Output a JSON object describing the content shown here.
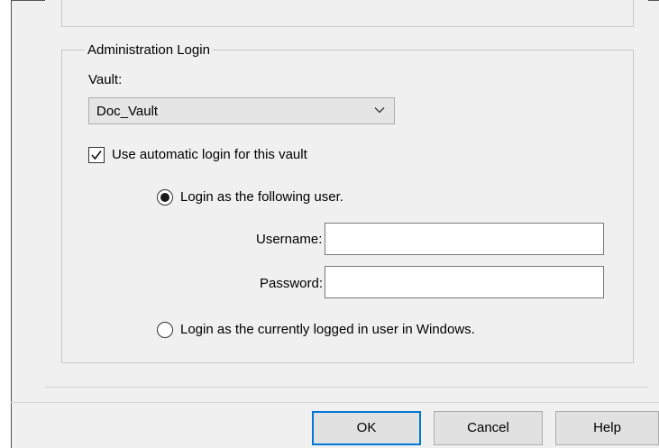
{
  "group": {
    "title": "Administration Login",
    "vault_label": "Vault:",
    "vault_selected": "Doc_Vault",
    "auto_login_label": "Use automatic login for this vault",
    "auto_login_checked": true,
    "radio_login_user_label": "Login as the following user.",
    "radio_login_user_selected": true,
    "username_label": "Username:",
    "username_value": "",
    "password_label": "Password:",
    "password_value": "",
    "radio_windows_user_label": "Login as the currently logged in user in Windows.",
    "radio_windows_user_selected": false
  },
  "buttons": {
    "ok": "OK",
    "cancel": "Cancel",
    "help": "Help"
  },
  "icons": {
    "combo_arrow": "chevron-down-icon",
    "checkbox_mark": "checkmark-icon"
  },
  "colors": {
    "default_button_border": "#0078d7"
  }
}
